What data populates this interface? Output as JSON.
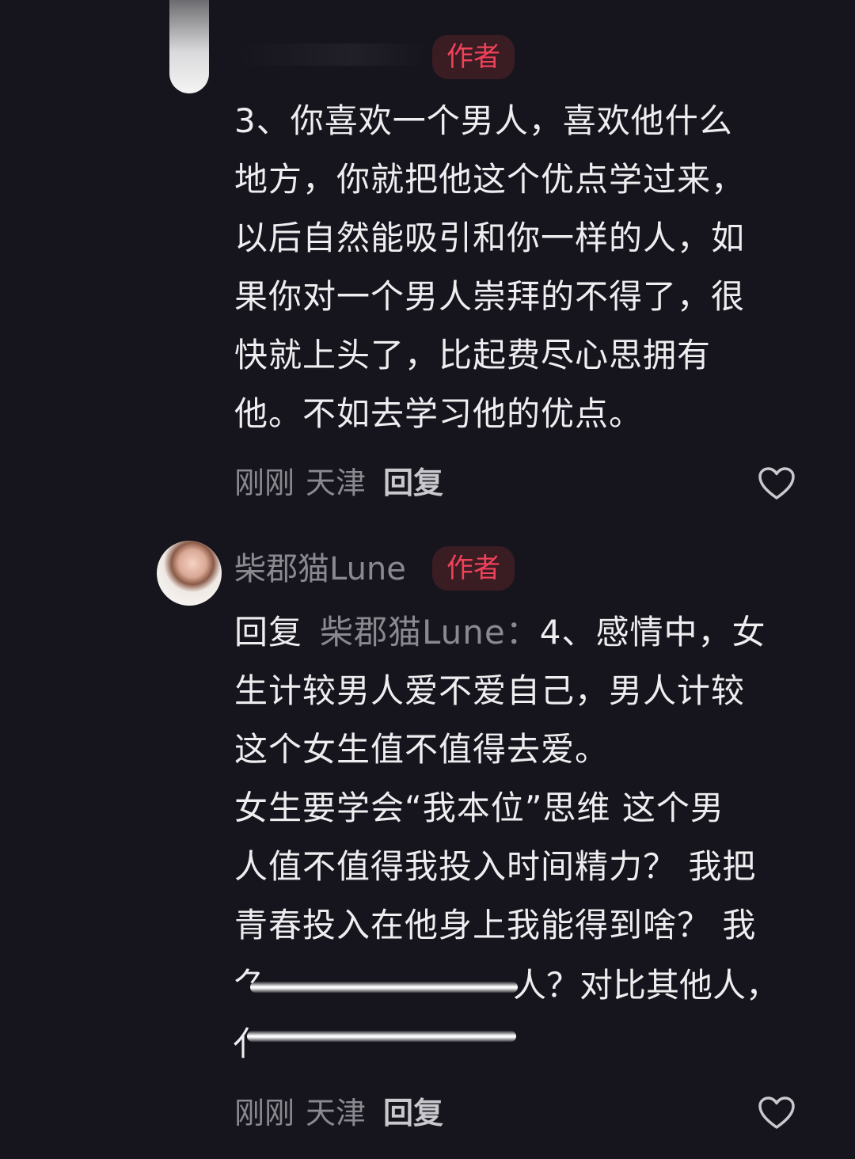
{
  "comments": [
    {
      "badge": "作者",
      "text_lines": [
        "3、你喜欢一个男人，喜欢他什么",
        "地方，你就把他这个优点学过来，",
        "以后自然能吸引和你一样的人，如",
        "果你对一个男人崇拜的不得了，很",
        "快就上头了，比起费尽心思拥有",
        "他。不如去学习他的优点。"
      ],
      "time": "刚刚",
      "location": "天津",
      "reply_label": "回复"
    },
    {
      "username": "柴郡猫Lune",
      "badge": "作者",
      "reply_prefix": "回复",
      "reply_target": "柴郡猫Lune：",
      "first_line_rest": "4、感情中，女",
      "text_lines": [
        "生计较男人爱不爱自己，男人计较",
        "这个女生值不值得去爱。",
        "女生要学会“我本位”思维 这个男",
        "人值不值得我投入时间精力？ 我把",
        "青春投入在他身上我能得到啥？ 我"
      ],
      "partial_line_start": "⺈",
      "partial_line_end": "人？对比其他人，",
      "last_partial_glyph": "亻",
      "time": "刚刚",
      "location": "天津",
      "reply_label": "回复"
    }
  ],
  "icons": {
    "like": "heart-outline-icon"
  },
  "colors": {
    "background": "#16151d",
    "badge_bg": "#3a1c23",
    "badge_text": "#f0425a",
    "text_primary": "#eeeef0",
    "text_secondary": "#8a8990"
  }
}
